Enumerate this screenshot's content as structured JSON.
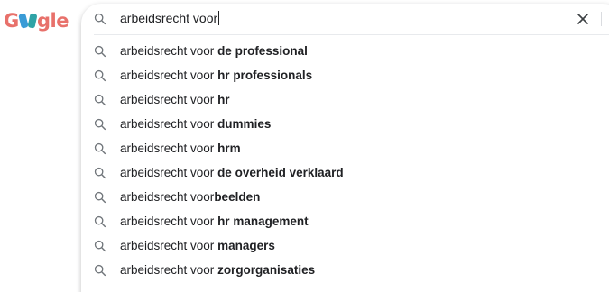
{
  "logo": {
    "label": "Google"
  },
  "search": {
    "query": "arbeidsrecht voor"
  },
  "suggestions": [
    {
      "prefix": "arbeidsrecht voor ",
      "completion": "de professional"
    },
    {
      "prefix": "arbeidsrecht voor ",
      "completion": "hr professionals"
    },
    {
      "prefix": "arbeidsrecht voor ",
      "completion": "hr"
    },
    {
      "prefix": "arbeidsrecht voor ",
      "completion": "dummies"
    },
    {
      "prefix": "arbeidsrecht voor ",
      "completion": "hrm"
    },
    {
      "prefix": "arbeidsrecht voor ",
      "completion": "de overheid verklaard"
    },
    {
      "prefix": "arbeidsrecht voor",
      "completion": "beelden"
    },
    {
      "prefix": "arbeidsrecht voor ",
      "completion": "hr management"
    },
    {
      "prefix": "arbeidsrecht voor ",
      "completion": "managers"
    },
    {
      "prefix": "arbeidsrecht voor ",
      "completion": "zorgorganisaties"
    }
  ],
  "icons": {
    "search": "search-icon",
    "clear": "close-icon"
  },
  "colors": {
    "icon_gray": "#70757a",
    "text": "#202124",
    "logo_red": "#e8716b",
    "logo_blue": "#3a9bd6",
    "logo_teal": "#2fa3a6"
  }
}
